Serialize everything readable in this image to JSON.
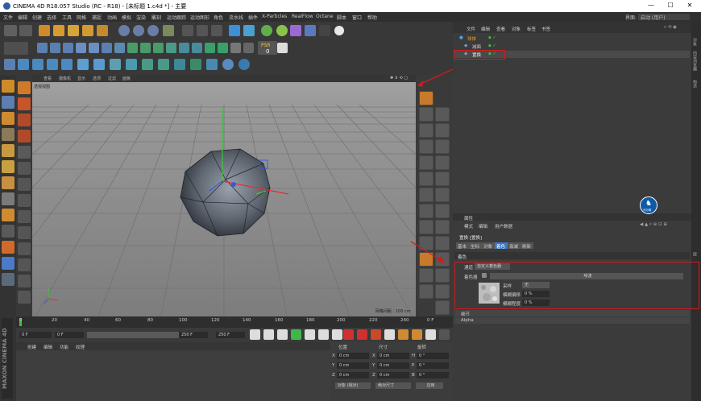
{
  "window": {
    "title": "CINEMA 4D R18.057 Studio (RC - R18) - [未标题 1.c4d *] - 主要",
    "minimize": "—",
    "maximize": "☐",
    "close": "✕"
  },
  "menu": [
    "文件",
    "编辑",
    "创建",
    "选择",
    "工具",
    "网格",
    "捕捉",
    "动画",
    "模拟",
    "渲染",
    "雕刻",
    "运动跟踪",
    "运动图形",
    "角色",
    "流水线",
    "插件",
    "X-Particles",
    "RealFlow",
    "Octane",
    "脚本",
    "窗口",
    "帮助"
  ],
  "interface": {
    "label": "界面:",
    "value": "启动 (用户)"
  },
  "viewport": {
    "menu": [
      "查看",
      "摄像机",
      "显示",
      "选项",
      "过滤",
      "面板"
    ],
    "view_name": "透视视图",
    "grid_info": "网格间距 : 100 cm"
  },
  "timeline": {
    "ticks": [
      "0",
      "20",
      "40",
      "60",
      "80",
      "100",
      "120",
      "140",
      "160",
      "180",
      "200",
      "220",
      "240"
    ],
    "end_label": "0 F"
  },
  "transport": {
    "current": "0 F",
    "start": "0 F",
    "end": "250 F",
    "end2": "250 F"
  },
  "material_manager": {
    "menu": [
      "创建",
      "编辑",
      "功能",
      "纹理"
    ]
  },
  "coordinates": {
    "headers": [
      "位置",
      "尺寸",
      "旋转"
    ],
    "rows": [
      {
        "axis": "X",
        "pos": "0 cm",
        "size": "0 cm",
        "rlabel": "H",
        "rot": "0 °"
      },
      {
        "axis": "Y",
        "pos": "0 cm",
        "size": "0 cm",
        "rlabel": "P",
        "rot": "0 °"
      },
      {
        "axis": "Z",
        "pos": "0 cm",
        "size": "0 cm",
        "rlabel": "B",
        "rot": "0 °"
      }
    ],
    "mode": "对象 (相对)",
    "size_mode": "绝对尺寸",
    "apply": "应用"
  },
  "object_manager": {
    "menu": [
      "文件",
      "编辑",
      "查看",
      "对象",
      "标签",
      "书签"
    ],
    "objects": [
      {
        "name": "球体",
        "color": "#e0a030"
      },
      {
        "name": "减面",
        "color": "#c8c8c8"
      },
      {
        "name": "置换",
        "color": "#d8d8d8"
      }
    ]
  },
  "right_tabs": [
    "对象",
    "内容浏览器",
    "构造",
    "层"
  ],
  "attributes": {
    "title": "属性",
    "menu": [
      "模式",
      "编辑",
      "用户数据"
    ],
    "object": "置换 [置换]",
    "tabs": [
      "基本",
      "坐标",
      "对象",
      "着色",
      "衰减",
      "刷新"
    ],
    "active_tab": "着色",
    "section": "着色",
    "channel_label": "通道",
    "channel_value": "自定义着色器",
    "shader_label": "着色器",
    "shader_value": "噪波",
    "sampling_label": "采样",
    "sampling_value": "无",
    "blur_scale_label": "模糊偏移",
    "blur_scale_value": "0 %",
    "blur_offset_label": "模糊程度",
    "blur_offset_value": "0 %",
    "fold1": "细节",
    "fold2": "Alpha"
  },
  "badge": {
    "text": "马尔斯"
  },
  "colors": {
    "highlight_red": "#d01c1c",
    "accent_blue": "#3a78c8",
    "tool_orange": "#d98b1f"
  }
}
